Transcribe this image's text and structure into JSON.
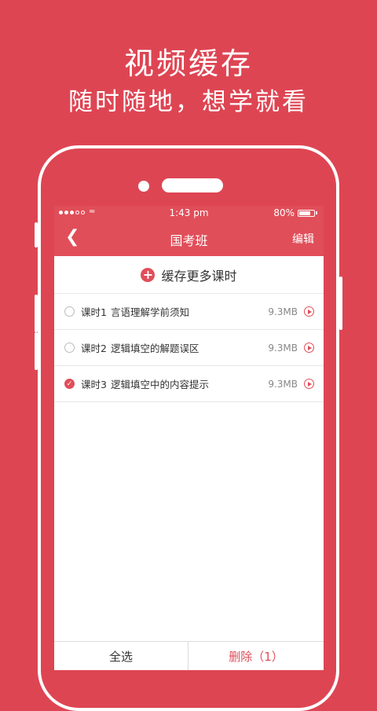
{
  "promo": {
    "title": "视频缓存",
    "subtitle": "随时随地，想学就看"
  },
  "statusbar": {
    "time": "1:43 pm",
    "battery": "80%",
    "battery_level": 0.8
  },
  "navbar": {
    "back_icon": "chevron-left",
    "title": "国考班",
    "edit_label": "编辑"
  },
  "add_more": {
    "label": "缓存更多课时"
  },
  "lessons": [
    {
      "number": "课时1",
      "name": "言语理解学前须知",
      "size": "9.3MB",
      "checked": false
    },
    {
      "number": "课时2",
      "name": "逻辑填空的解题误区",
      "size": "9.3MB",
      "checked": false
    },
    {
      "number": "课时3",
      "name": "逻辑填空中的内容提示",
      "size": "9.3MB",
      "checked": true
    }
  ],
  "bottom": {
    "select_all": "全选",
    "delete": "删除（1）"
  },
  "colors": {
    "accent": "#e04e59",
    "background": "#de4553"
  }
}
